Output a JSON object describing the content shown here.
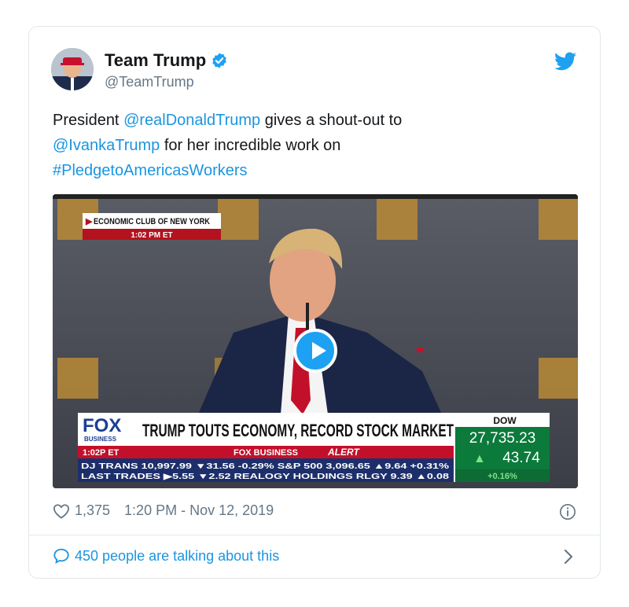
{
  "account": {
    "name": "Team Trump",
    "handle": "@TeamTrump"
  },
  "tweet": {
    "line1_prefix": "President ",
    "mention1": "@realDonaldTrump",
    "line1_suffix": " gives a shout-out to",
    "mention2": "@IvankaTrump",
    "line2_suffix": " for her incredible work on",
    "hashtag": "#PledgetoAmericasWorkers"
  },
  "video": {
    "event_label": "ECONOMIC CLUB OF NEW YORK",
    "event_time": "1:02 PM ET",
    "network": "FOX",
    "network_sub": "BUSINESS",
    "headline": "TRUMP TOUTS ECONOMY, RECORD STOCK MARKET",
    "clock": "1:02P ET",
    "alert_brand": "FOX BUSINESS",
    "alert_word": "ALERT",
    "ticker_row1": "DJ TRANS 10,997.99 ▼31.56 -0.29%  S&P 500  3,096.65 ▲9.64 +0.31%",
    "ticker_row2": "LAST TRADES ▶5.55 ▼2.52  REALOGY HOLDINGS RLGY 9.39 ▲0.08",
    "dow_label": "DOW",
    "dow_value": "27,735.23",
    "dow_change": "43.74",
    "dow_pct": "+0.16%"
  },
  "stats": {
    "likes": "1,375",
    "timestamp": "1:20 PM - Nov 12, 2019"
  },
  "footer": {
    "talking": "450 people are talking about this"
  },
  "icons": [
    "verified-icon",
    "twitter-bird-icon",
    "heart-icon",
    "info-icon",
    "speech-bubble-icon",
    "chevron-right-icon",
    "play-icon"
  ],
  "colors": {
    "link": "#1b95e0",
    "twitter_blue": "#1da1f2",
    "muted": "#657786"
  }
}
